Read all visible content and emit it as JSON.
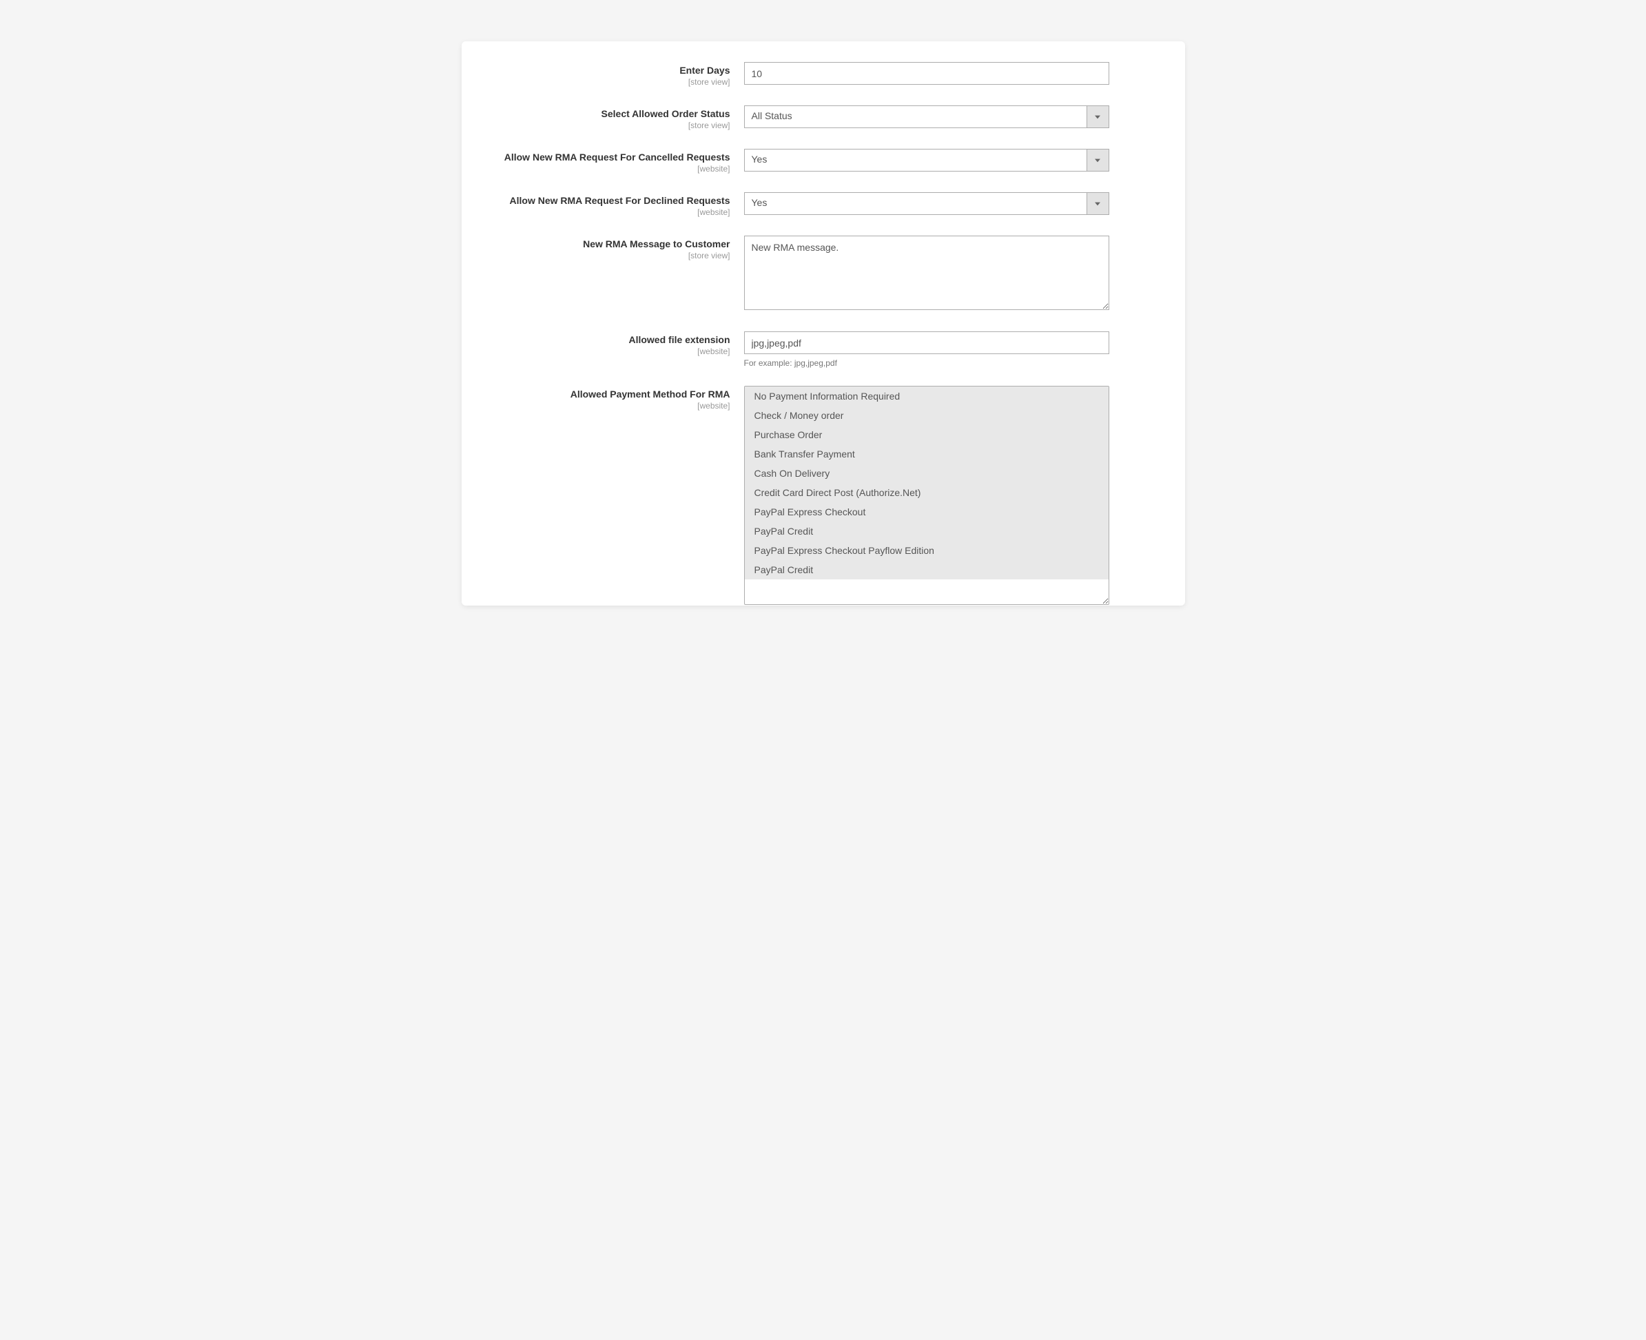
{
  "fields": {
    "enterDays": {
      "label": "Enter Days",
      "scope": "[store view]",
      "value": "10"
    },
    "allowedOrderStatus": {
      "label": "Select Allowed Order Status",
      "scope": "[store view]",
      "value": "All Status"
    },
    "allowCancelled": {
      "label": "Allow New RMA Request For Cancelled Requests",
      "scope": "[website]",
      "value": "Yes"
    },
    "allowDeclined": {
      "label": "Allow New RMA Request For Declined Requests",
      "scope": "[website]",
      "value": "Yes"
    },
    "newRmaMessage": {
      "label": "New RMA Message to Customer",
      "scope": "[store view]",
      "value": "New RMA message."
    },
    "allowedFileExt": {
      "label": "Allowed file extension",
      "scope": "[website]",
      "value": "jpg,jpeg,pdf",
      "hint": "For example: jpg,jpeg,pdf"
    },
    "allowedPayment": {
      "label": "Allowed Payment Method For RMA",
      "scope": "[website]",
      "options": [
        "No Payment Information Required",
        "Check / Money order",
        "Purchase Order",
        "Bank Transfer Payment",
        "Cash On Delivery",
        "Credit Card Direct Post (Authorize.Net)",
        "PayPal Express Checkout",
        "PayPal Credit",
        "PayPal Express Checkout Payflow Edition",
        "PayPal Credit"
      ]
    }
  }
}
